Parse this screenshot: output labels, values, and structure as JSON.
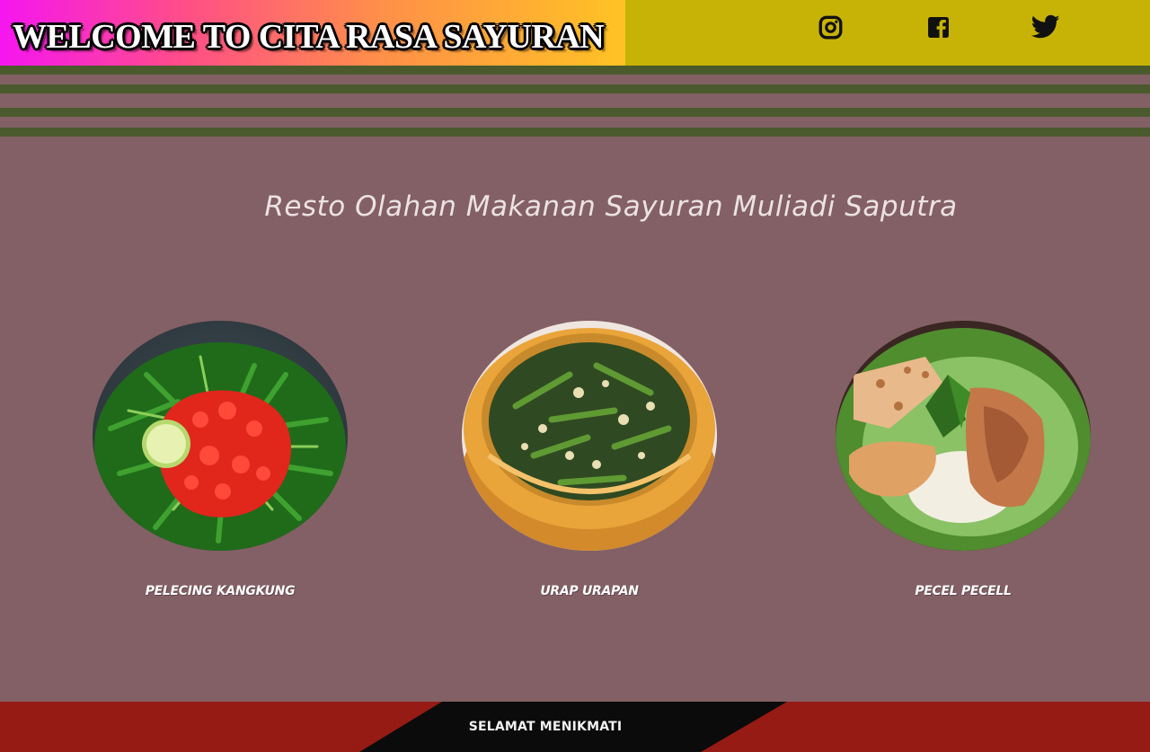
{
  "header": {
    "title": "WELCOME TO CITA RASA SAYURAN",
    "social": [
      {
        "icon": "instagram-icon"
      },
      {
        "icon": "facebook-icon"
      },
      {
        "icon": "twitter-icon"
      }
    ]
  },
  "hero": {
    "subtitle": "Resto Olahan Makanan Sayuran Muliadi Saputra"
  },
  "dishes": [
    {
      "name": "PELECING KANGKUNG"
    },
    {
      "name": "URAP URAPAN"
    },
    {
      "name": "PECEL PECELL"
    }
  ],
  "footer": {
    "text": "SELAMAT MENIKMATI"
  },
  "colors": {
    "background": "#836065",
    "header": "#c7b305",
    "stripes": "#4a5a2c",
    "footer": "#951b14",
    "footer_band": "#0b0b0b"
  }
}
